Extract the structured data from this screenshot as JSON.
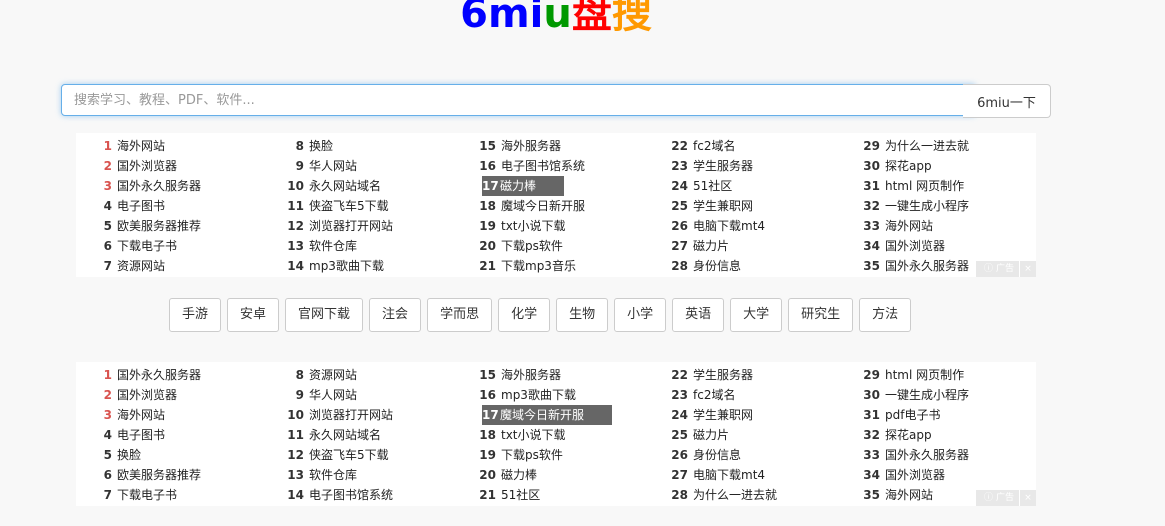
{
  "logo": {
    "parts": [
      {
        "text": "6",
        "color": "#0000ff"
      },
      {
        "text": "mi",
        "color": "#0000ff"
      },
      {
        "text": "u",
        "color": "#009900"
      },
      {
        "text": "盘",
        "color": "#ff0000"
      },
      {
        "text": "搜",
        "color": "#ff9900"
      }
    ]
  },
  "search": {
    "placeholder": "搜索学习、教程、PDF、软件...",
    "value": "",
    "button_label": "6miu一下"
  },
  "hot_lists": [
    {
      "highlight_num": "17",
      "items": [
        {
          "num": "1",
          "text": "海外网站"
        },
        {
          "num": "2",
          "text": "国外浏览器"
        },
        {
          "num": "3",
          "text": "国外永久服务器"
        },
        {
          "num": "4",
          "text": "电子图书"
        },
        {
          "num": "5",
          "text": "欧美服务器推荐"
        },
        {
          "num": "6",
          "text": "下载电子书"
        },
        {
          "num": "7",
          "text": "资源网站"
        },
        {
          "num": "8",
          "text": "换脸"
        },
        {
          "num": "9",
          "text": "华人网站"
        },
        {
          "num": "10",
          "text": "永久网站域名"
        },
        {
          "num": "11",
          "text": "侠盗飞车5下载"
        },
        {
          "num": "12",
          "text": "浏览器打开网站"
        },
        {
          "num": "13",
          "text": "软件仓库"
        },
        {
          "num": "14",
          "text": "mp3歌曲下载"
        },
        {
          "num": "15",
          "text": "海外服务器"
        },
        {
          "num": "16",
          "text": "电子图书馆系统"
        },
        {
          "num": "17",
          "text": "磁力棒"
        },
        {
          "num": "18",
          "text": "魔域今日新开服"
        },
        {
          "num": "19",
          "text": "txt小说下载"
        },
        {
          "num": "20",
          "text": "下载ps软件"
        },
        {
          "num": "21",
          "text": "下载mp3音乐"
        },
        {
          "num": "22",
          "text": "fc2域名"
        },
        {
          "num": "23",
          "text": "学生服务器"
        },
        {
          "num": "24",
          "text": "51社区"
        },
        {
          "num": "25",
          "text": "学生兼职网"
        },
        {
          "num": "26",
          "text": "电脑下载mt4"
        },
        {
          "num": "27",
          "text": "磁力片"
        },
        {
          "num": "28",
          "text": "身份信息"
        },
        {
          "num": "29",
          "text": "为什么一进去就"
        },
        {
          "num": "30",
          "text": "探花app"
        },
        {
          "num": "31",
          "text": "html 网页制作"
        },
        {
          "num": "32",
          "text": "一键生成小程序"
        },
        {
          "num": "33",
          "text": "海外网站"
        },
        {
          "num": "34",
          "text": "国外浏览器"
        },
        {
          "num": "35",
          "text": "国外永久服务器"
        }
      ],
      "ad_label": "广告",
      "ad_close": "×"
    },
    {
      "highlight_num": "17",
      "items": [
        {
          "num": "1",
          "text": "国外永久服务器"
        },
        {
          "num": "2",
          "text": "国外浏览器"
        },
        {
          "num": "3",
          "text": "海外网站"
        },
        {
          "num": "4",
          "text": "电子图书"
        },
        {
          "num": "5",
          "text": "换脸"
        },
        {
          "num": "6",
          "text": "欧美服务器推荐"
        },
        {
          "num": "7",
          "text": "下载电子书"
        },
        {
          "num": "8",
          "text": "资源网站"
        },
        {
          "num": "9",
          "text": "华人网站"
        },
        {
          "num": "10",
          "text": "浏览器打开网站"
        },
        {
          "num": "11",
          "text": "永久网站域名"
        },
        {
          "num": "12",
          "text": "侠盗飞车5下载"
        },
        {
          "num": "13",
          "text": "软件仓库"
        },
        {
          "num": "14",
          "text": "电子图书馆系统"
        },
        {
          "num": "15",
          "text": "海外服务器"
        },
        {
          "num": "16",
          "text": "mp3歌曲下载"
        },
        {
          "num": "17",
          "text": "魔域今日新开服"
        },
        {
          "num": "18",
          "text": "txt小说下载"
        },
        {
          "num": "19",
          "text": "下载ps软件"
        },
        {
          "num": "20",
          "text": "磁力棒"
        },
        {
          "num": "21",
          "text": "51社区"
        },
        {
          "num": "22",
          "text": "学生服务器"
        },
        {
          "num": "23",
          "text": "fc2域名"
        },
        {
          "num": "24",
          "text": "学生兼职网"
        },
        {
          "num": "25",
          "text": "磁力片"
        },
        {
          "num": "26",
          "text": "身份信息"
        },
        {
          "num": "27",
          "text": "电脑下载mt4"
        },
        {
          "num": "28",
          "text": "为什么一进去就"
        },
        {
          "num": "29",
          "text": "html 网页制作"
        },
        {
          "num": "30",
          "text": "一键生成小程序"
        },
        {
          "num": "31",
          "text": "pdf电子书"
        },
        {
          "num": "32",
          "text": "探花app"
        },
        {
          "num": "33",
          "text": "国外永久服务器"
        },
        {
          "num": "34",
          "text": "国外浏览器"
        },
        {
          "num": "35",
          "text": "海外网站"
        }
      ],
      "ad_label": "广告",
      "ad_close": "×"
    }
  ],
  "tags": [
    "手游",
    "安卓",
    "官网下载",
    "注会",
    "学而思",
    "化学",
    "生物",
    "小学",
    "英语",
    "大学",
    "研究生",
    "方法"
  ]
}
